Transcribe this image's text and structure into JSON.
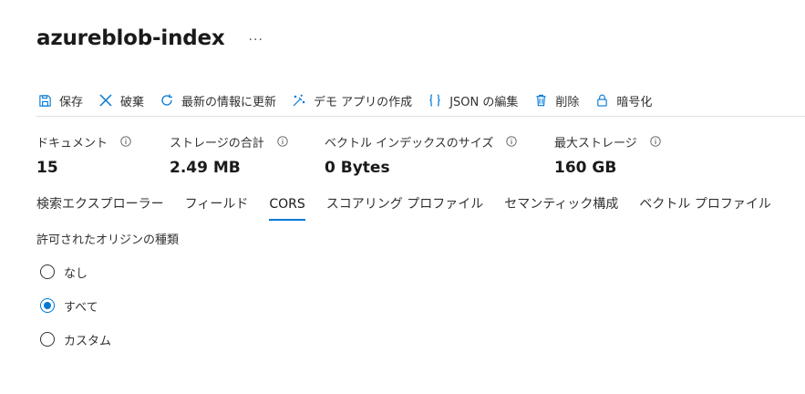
{
  "header": {
    "title": "azureblob-index",
    "more": "···"
  },
  "toolbar": {
    "items": [
      {
        "label": "保存",
        "icon": "save-icon"
      },
      {
        "label": "破棄",
        "icon": "close-icon"
      },
      {
        "label": "最新の情報に更新",
        "icon": "refresh-icon"
      },
      {
        "label": "デモ アプリの作成",
        "icon": "demo-app-icon"
      },
      {
        "label": "JSON の編集",
        "icon": "json-braces-icon"
      },
      {
        "label": "削除",
        "icon": "trash-icon"
      },
      {
        "label": "暗号化",
        "icon": "lock-icon"
      }
    ]
  },
  "stats": [
    {
      "label": "ドキュメント",
      "value": "15"
    },
    {
      "label": "ストレージの合計",
      "value": "2.49 MB"
    },
    {
      "label": "ベクトル インデックスのサイズ",
      "value": "0 Bytes"
    },
    {
      "label": "最大ストレージ",
      "value": "160 GB"
    }
  ],
  "tabs": [
    {
      "label": "検索エクスプローラー"
    },
    {
      "label": "フィールド"
    },
    {
      "label": "CORS"
    },
    {
      "label": "スコアリング プロファイル"
    },
    {
      "label": "セマンティック構成"
    },
    {
      "label": "ベクトル プロファイル"
    }
  ],
  "active_tab": "CORS",
  "cors": {
    "label": "許可されたオリジンの種類",
    "options": [
      {
        "label": "なし"
      },
      {
        "label": "すべて"
      },
      {
        "label": "カスタム"
      }
    ],
    "selected": "すべて"
  },
  "colors": {
    "accent": "#0078d4",
    "text": "#323130",
    "divider": "#e1dfdd"
  }
}
